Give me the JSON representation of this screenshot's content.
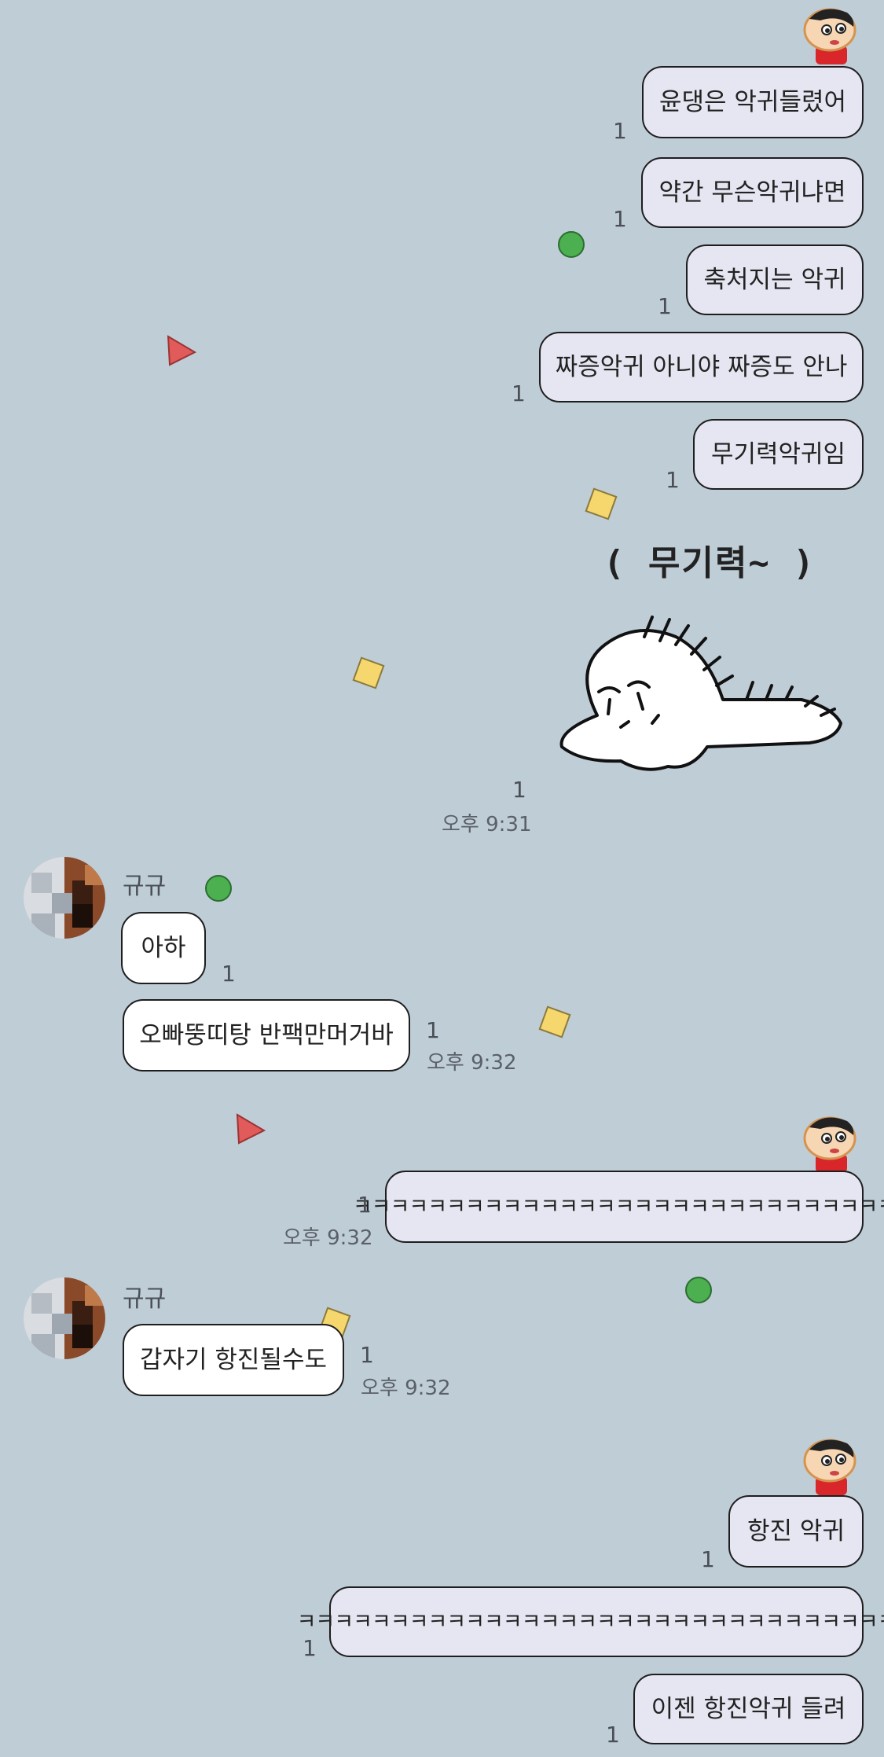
{
  "my_messages": [
    {
      "text": "윤댕은 악귀들렸어",
      "read_count": "1"
    },
    {
      "text": "약간 무슨악귀냐면",
      "read_count": "1"
    },
    {
      "text": "축처지는 악귀",
      "read_count": "1"
    },
    {
      "text": "짜증악귀 아니야 짜증도 안나",
      "read_count": "1"
    },
    {
      "text": "무기력악귀임",
      "read_count": "1"
    },
    {
      "text": "ㅋㅋㅋㅋㅋㅋㅋㅋㅋㅋㅋㅋㅋㅋㅋㅋㅋㅋㅋㅋㅋㅋㅋㅋㅋㅋㅋㅋㅋ",
      "read_count": "1",
      "time": "오후 9:32"
    },
    {
      "text": "항진 악귀",
      "read_count": "1"
    },
    {
      "text": "ㅋㅋㅋㅋㅋㅋㅋㅋㅋㅋㅋㅋㅋㅋㅋㅋㅋㅋㅋㅋㅋㅋㅋㅋㅋㅋㅋㅋㅋㅋㅋㅋ",
      "read_count": "1"
    },
    {
      "text": "이젠 항진악귀 들려",
      "read_count": "1"
    }
  ],
  "sticker": {
    "text": "( 무기력~ )",
    "read_count": "1",
    "time": "오후 9:31"
  },
  "friend": {
    "name": "규규",
    "messages": [
      {
        "text": "아하",
        "read_count": "1"
      },
      {
        "text": "오빠뚱띠탕 반팩만머거바",
        "read_count": "1",
        "time": "오후 9:32"
      },
      {
        "text": "갑자기 항진될수도",
        "read_count": "1",
        "time": "오후 9:32"
      }
    ]
  },
  "icons": {
    "my_avatar": "cartoon-boy-avatar-icon",
    "friend_avatar": "pixelated-profile-photo",
    "sticker": "lazy-blob-sticker"
  },
  "colors": {
    "background": "#bfcdd7",
    "my_bubble": "#e5e6f2",
    "friend_bubble": "#ffffff",
    "deco_green": "#4caf50",
    "deco_red": "#e15b5b",
    "deco_yellow": "#f5d76e"
  }
}
